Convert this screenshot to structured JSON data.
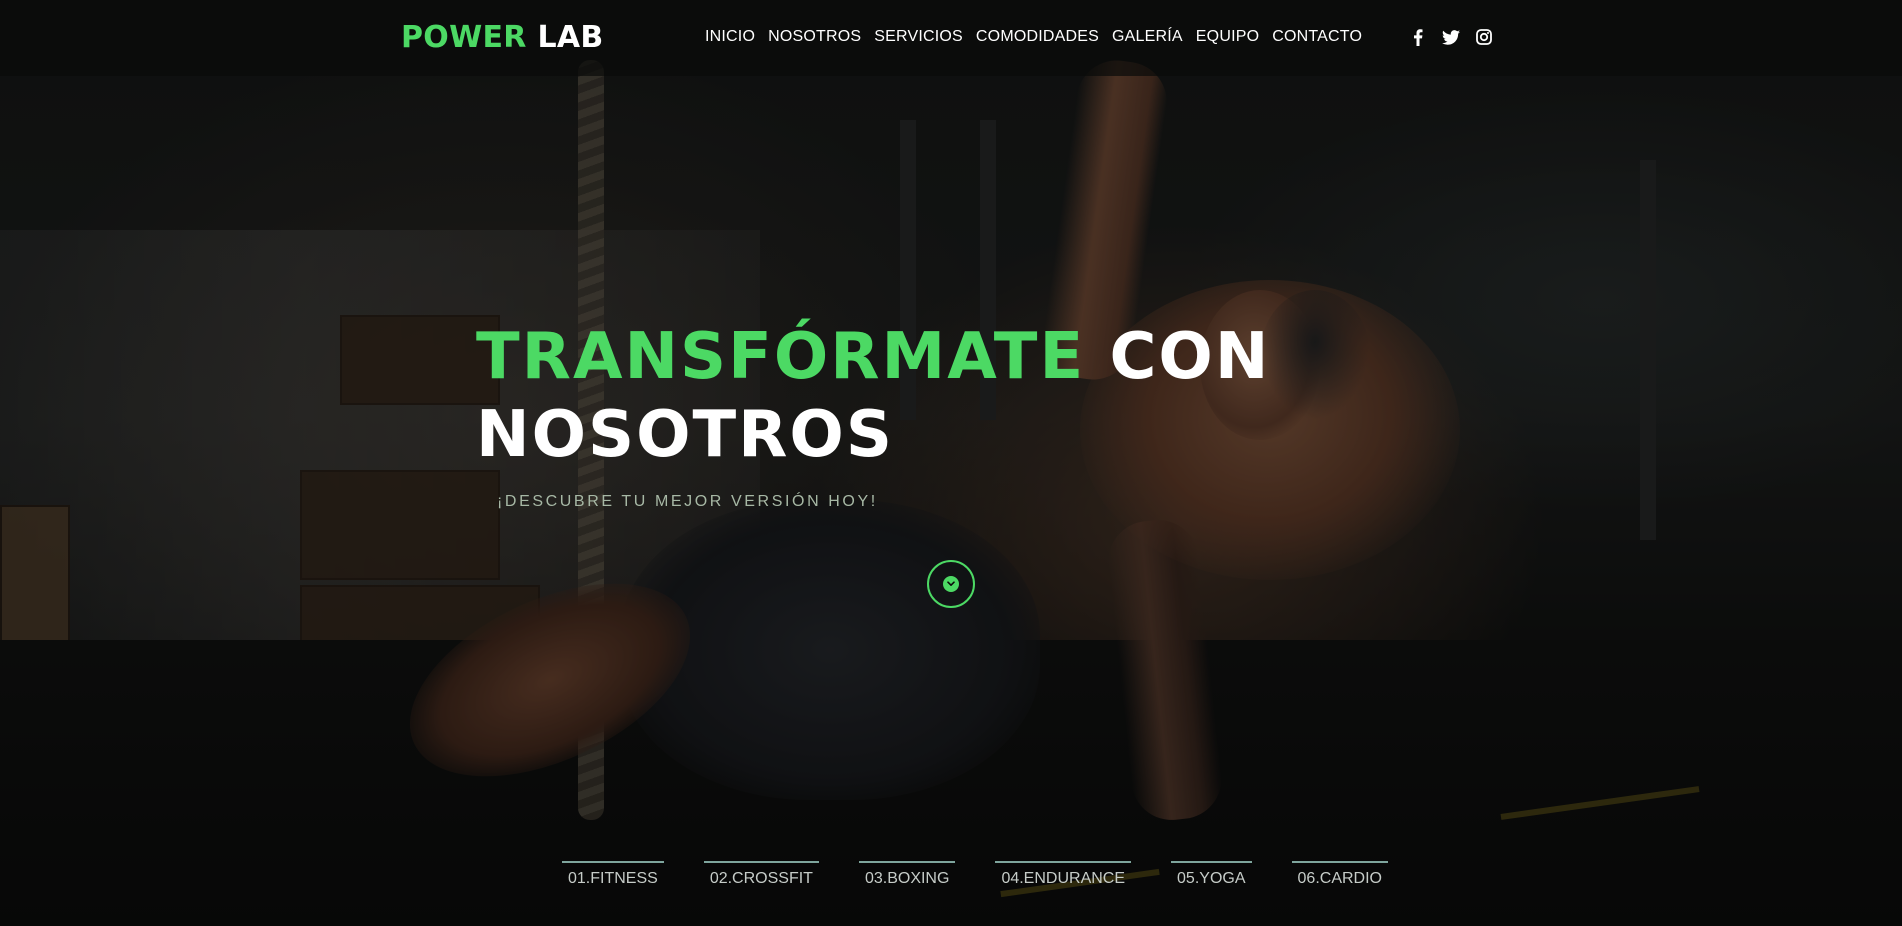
{
  "brand": {
    "part1": "POWER",
    "part2": "LAB"
  },
  "nav": {
    "items": [
      {
        "label": "INICIO"
      },
      {
        "label": "NOSOTROS"
      },
      {
        "label": "SERVICIOS"
      },
      {
        "label": "COMODIDADES"
      },
      {
        "label": "GALERÍA"
      },
      {
        "label": "EQUIPO"
      },
      {
        "label": "CONTACTO"
      }
    ]
  },
  "social": {
    "icons": [
      "facebook-icon",
      "twitter-icon",
      "instagram-icon"
    ]
  },
  "hero": {
    "title_highlight": "TRANSFÓRMATE",
    "title_rest_1": "CON",
    "title_rest_2": "NOSOTROS",
    "subtitle": "¡DESCUBRE TU MEJOR VERSIÓN HOY!",
    "scroll_icon": "chevron-down-icon"
  },
  "categories": [
    {
      "label": "01.FITNESS"
    },
    {
      "label": "02.CROSSFIT"
    },
    {
      "label": "03.BOXING"
    },
    {
      "label": "04.ENDURANCE"
    },
    {
      "label": "05.YOGA"
    },
    {
      "label": "06.CARDIO"
    }
  ],
  "colors": {
    "accent": "#4cd964",
    "text": "#ffffff",
    "subtitle": "#a7b8a5",
    "tab_border": "#7ea59d"
  }
}
